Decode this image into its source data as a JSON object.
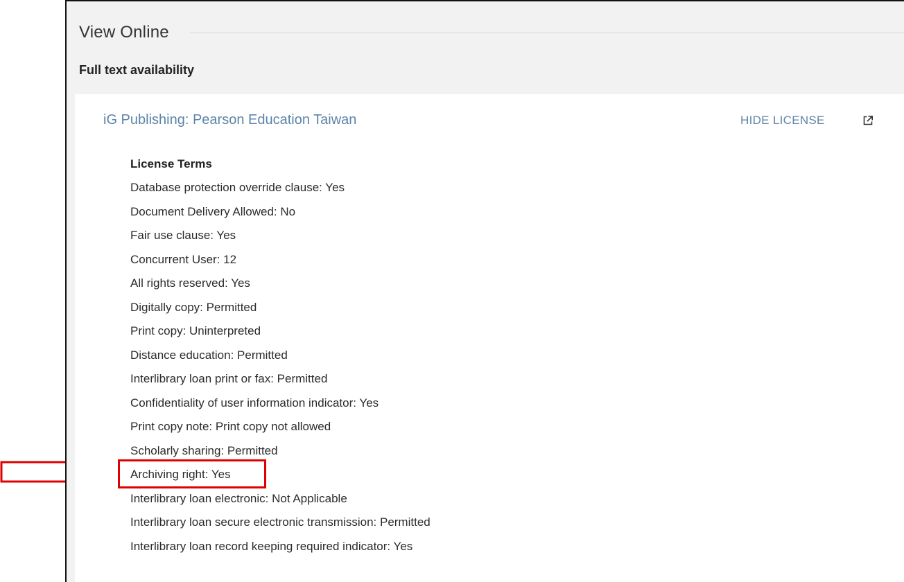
{
  "section": {
    "title": "View Online",
    "subheading": "Full text availability"
  },
  "service": {
    "name": "iG Publishing: Pearson Education Taiwan",
    "hide_license_label": "HIDE LICENSE",
    "external_icon": "external-link-icon"
  },
  "license": {
    "heading": "License Terms",
    "terms": [
      "Database protection override clause: Yes",
      "Document Delivery Allowed: No",
      "Fair use clause: Yes",
      "Concurrent User: 12",
      "All rights reserved: Yes",
      "Digitally copy: Permitted",
      "Print copy: Uninterpreted",
      "Distance education: Permitted",
      "Interlibrary loan print or fax: Permitted",
      "Confidentiality of user information indicator: Yes",
      "Print copy note: Print copy not allowed",
      "Scholarly sharing: Permitted",
      "Archiving right: Yes",
      "Interlibrary loan electronic: Not Applicable",
      "Interlibrary loan secure electronic transmission: Permitted",
      "Interlibrary loan record keeping required indicator: Yes"
    ]
  },
  "annotation": {
    "highlight_color": "#e00000",
    "highlighted_term": "Archiving right: Yes"
  },
  "colors": {
    "link": "#5c84a8",
    "background": "#f2f2f2",
    "card": "#ffffff"
  }
}
